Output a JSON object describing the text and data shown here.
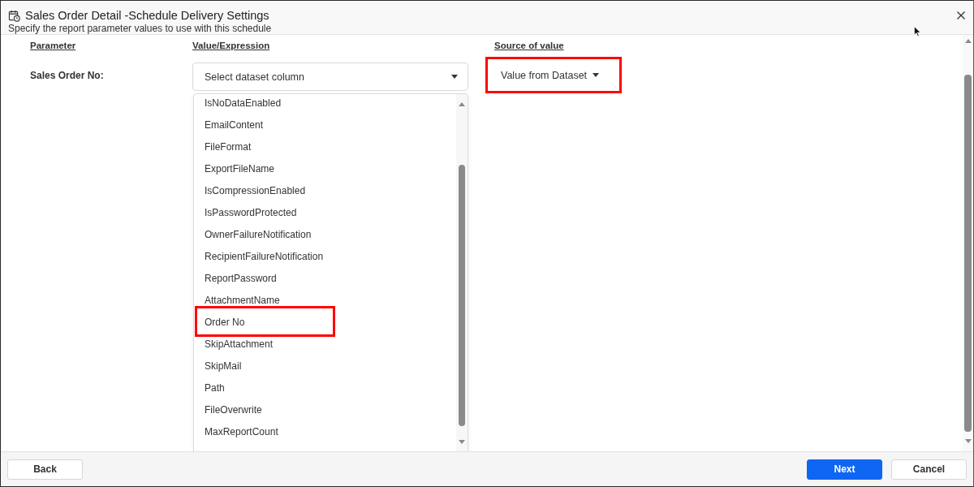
{
  "window": {
    "title": "Sales Order Detail -Schedule Delivery Settings",
    "subtitle": "Specify the report parameter values to use with this schedule"
  },
  "columns": [
    "Parameter",
    "Value/Expression",
    "Source of value"
  ],
  "parameters": [
    {
      "name": "Sales Order No:",
      "placeholder": "Select dataset column",
      "source": "Value from Dataset",
      "source_highlighted": true,
      "dropdown": {
        "expanded": true,
        "options": [
          {
            "label": "IsNoDataEnabled",
            "highlighted": false
          },
          {
            "label": "EmailContent",
            "highlighted": false
          },
          {
            "label": "FileFormat",
            "highlighted": false
          },
          {
            "label": "ExportFileName",
            "highlighted": false
          },
          {
            "label": "IsCompressionEnabled",
            "highlighted": false
          },
          {
            "label": "IsPasswordProtected",
            "highlighted": false
          },
          {
            "label": "OwnerFailureNotification",
            "highlighted": false
          },
          {
            "label": "RecipientFailureNotification",
            "highlighted": false
          },
          {
            "label": "ReportPassword",
            "highlighted": false
          },
          {
            "label": "AttachmentName",
            "highlighted": false
          },
          {
            "label": "Order No",
            "highlighted": true
          },
          {
            "label": "SkipAttachment",
            "highlighted": false
          },
          {
            "label": "SkipMail",
            "highlighted": false
          },
          {
            "label": "Path",
            "highlighted": false
          },
          {
            "label": "FileOverwrite",
            "highlighted": false
          },
          {
            "label": "MaxReportCount",
            "highlighted": false
          }
        ]
      }
    }
  ],
  "footer": {
    "left": [
      {
        "label": "Back",
        "kind": "secondary"
      }
    ],
    "right": [
      {
        "label": "Next",
        "kind": "primary"
      },
      {
        "label": "Cancel",
        "kind": "secondary"
      }
    ]
  }
}
